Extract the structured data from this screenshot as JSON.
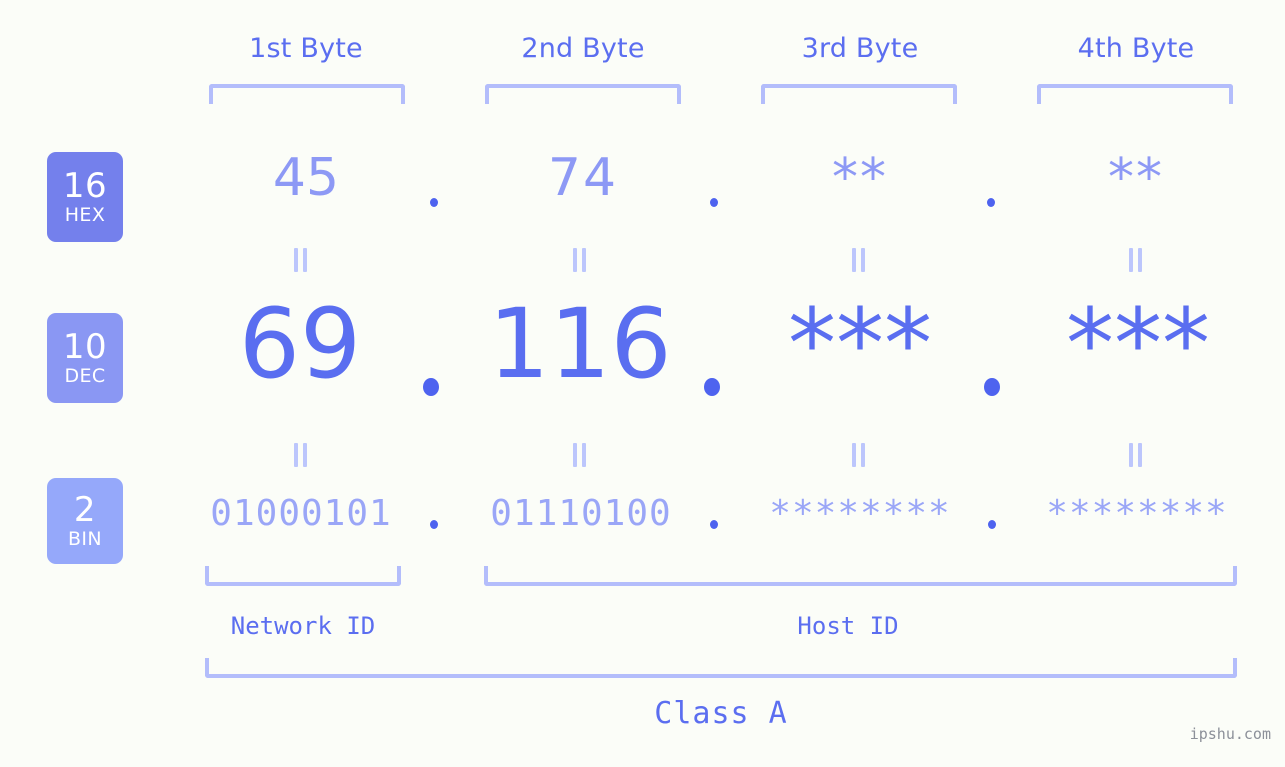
{
  "watermark": "ipshu.com",
  "colors": {
    "background": "#fbfdf8",
    "accent_strong": "#5a6ef0",
    "accent_mid": "#8d99f5",
    "accent_light": "#b3bdfb",
    "badge_hex": "#7480ec",
    "badge_dec": "#8a97f3",
    "badge_bin": "#95a8fa",
    "watermark_text": "#8c9099"
  },
  "byte_headers": [
    {
      "label": "1st Byte"
    },
    {
      "label": "2nd Byte"
    },
    {
      "label": "3rd Byte"
    },
    {
      "label": "4th Byte"
    }
  ],
  "bases": [
    {
      "key": "hex",
      "number": "16",
      "abbr": "HEX"
    },
    {
      "key": "dec",
      "number": "10",
      "abbr": "DEC"
    },
    {
      "key": "bin",
      "number": "2",
      "abbr": "BIN"
    }
  ],
  "rows": {
    "hex": {
      "values": [
        "45",
        "74",
        "**",
        "**"
      ],
      "separator": "."
    },
    "dec": {
      "values": [
        "69",
        "116",
        "***",
        "***"
      ],
      "separator": "."
    },
    "bin": {
      "values": [
        "01000101",
        "01110100",
        "********",
        "********"
      ],
      "separator": "."
    }
  },
  "segments": {
    "network_id": "Network ID",
    "host_id": "Host ID"
  },
  "class": "Class A"
}
